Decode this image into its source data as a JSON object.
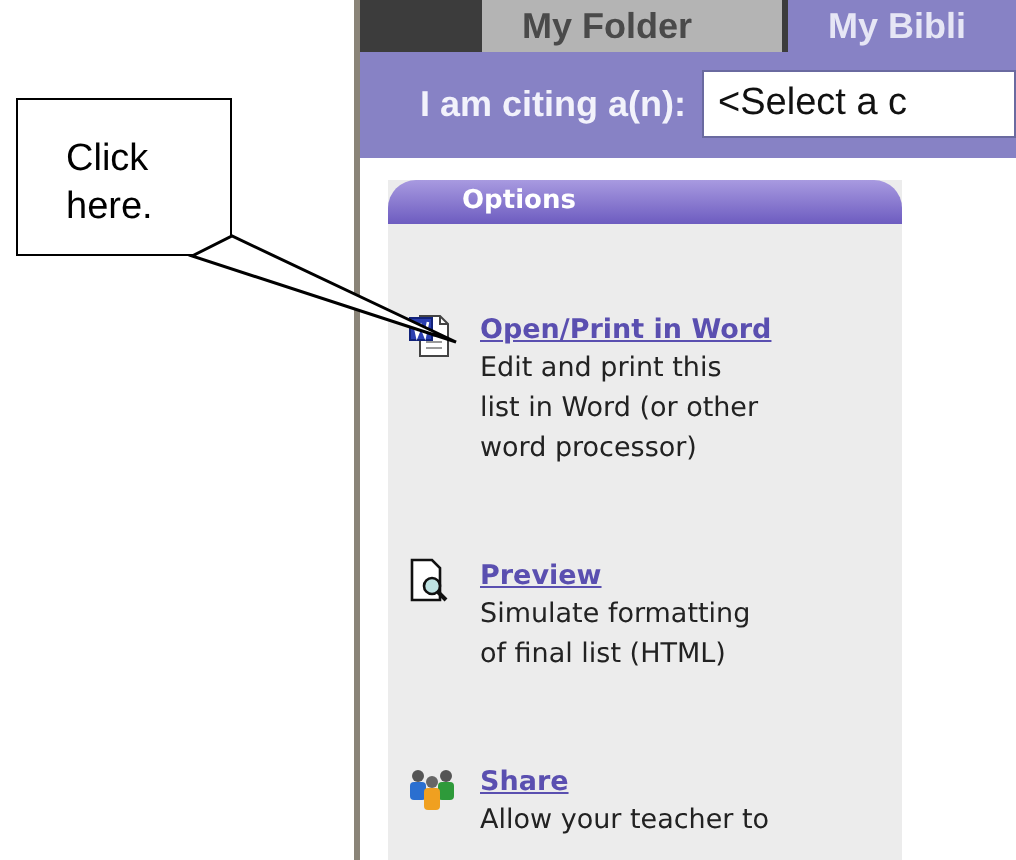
{
  "callout": {
    "text": "Click here."
  },
  "tabs": [
    {
      "label": "My Folder",
      "selected": false
    },
    {
      "label": "My Bibli",
      "selected": true
    }
  ],
  "citing": {
    "label": "I am citing a(n):",
    "value": "<Select a c"
  },
  "options": {
    "title": "Options",
    "items": [
      {
        "kind": "word",
        "title": "Open/Print in Word",
        "lines": [
          "Edit and print this",
          "list in Word (or other",
          "word processor)"
        ]
      },
      {
        "kind": "preview",
        "title": "Preview",
        "lines": [
          "Simulate formatting",
          "of final list (HTML)"
        ]
      },
      {
        "kind": "share",
        "title": "Share",
        "lines": [
          "Allow your teacher to"
        ]
      }
    ]
  }
}
